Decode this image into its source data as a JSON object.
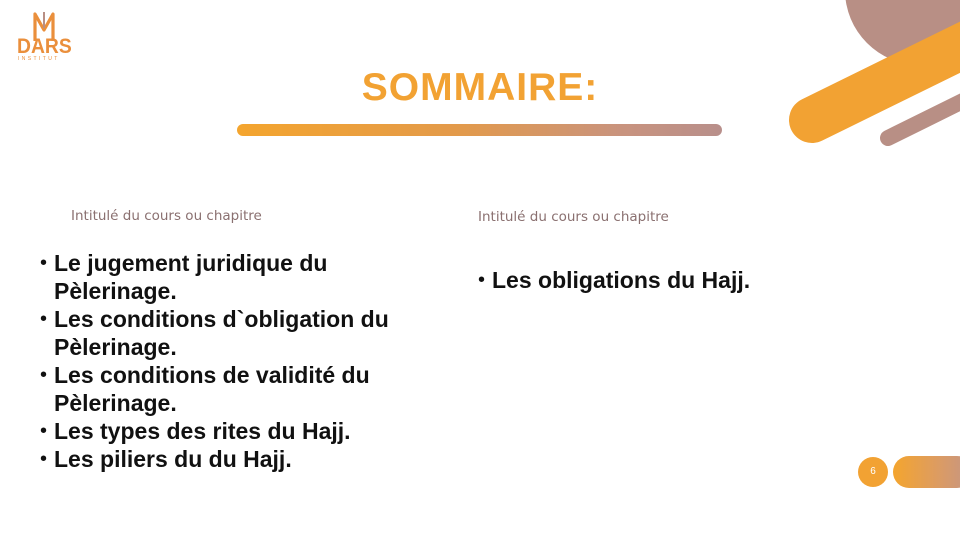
{
  "logo": {
    "name": "DARS",
    "subtitle": "INSTITUT"
  },
  "title": "SOMMAIRE:",
  "columns": [
    {
      "label": "Intitulé du cours ou chapitre",
      "items": [
        "Le jugement juridique du Pèlerinage.",
        "Les conditions d`obligation du Pèlerinage.",
        "Les conditions de validité du Pèlerinage.",
        "Les types des rites du Hajj.",
        "Les piliers du du Hajj."
      ]
    },
    {
      "label": "Intitulé du cours ou chapitre",
      "items": [
        "Les obligations du Hajj."
      ]
    }
  ],
  "page_number": "6",
  "colors": {
    "accent_orange": "#f2a233",
    "accent_mauve": "#b88f85",
    "text": "#111111",
    "subtitle": "#8a7070"
  }
}
